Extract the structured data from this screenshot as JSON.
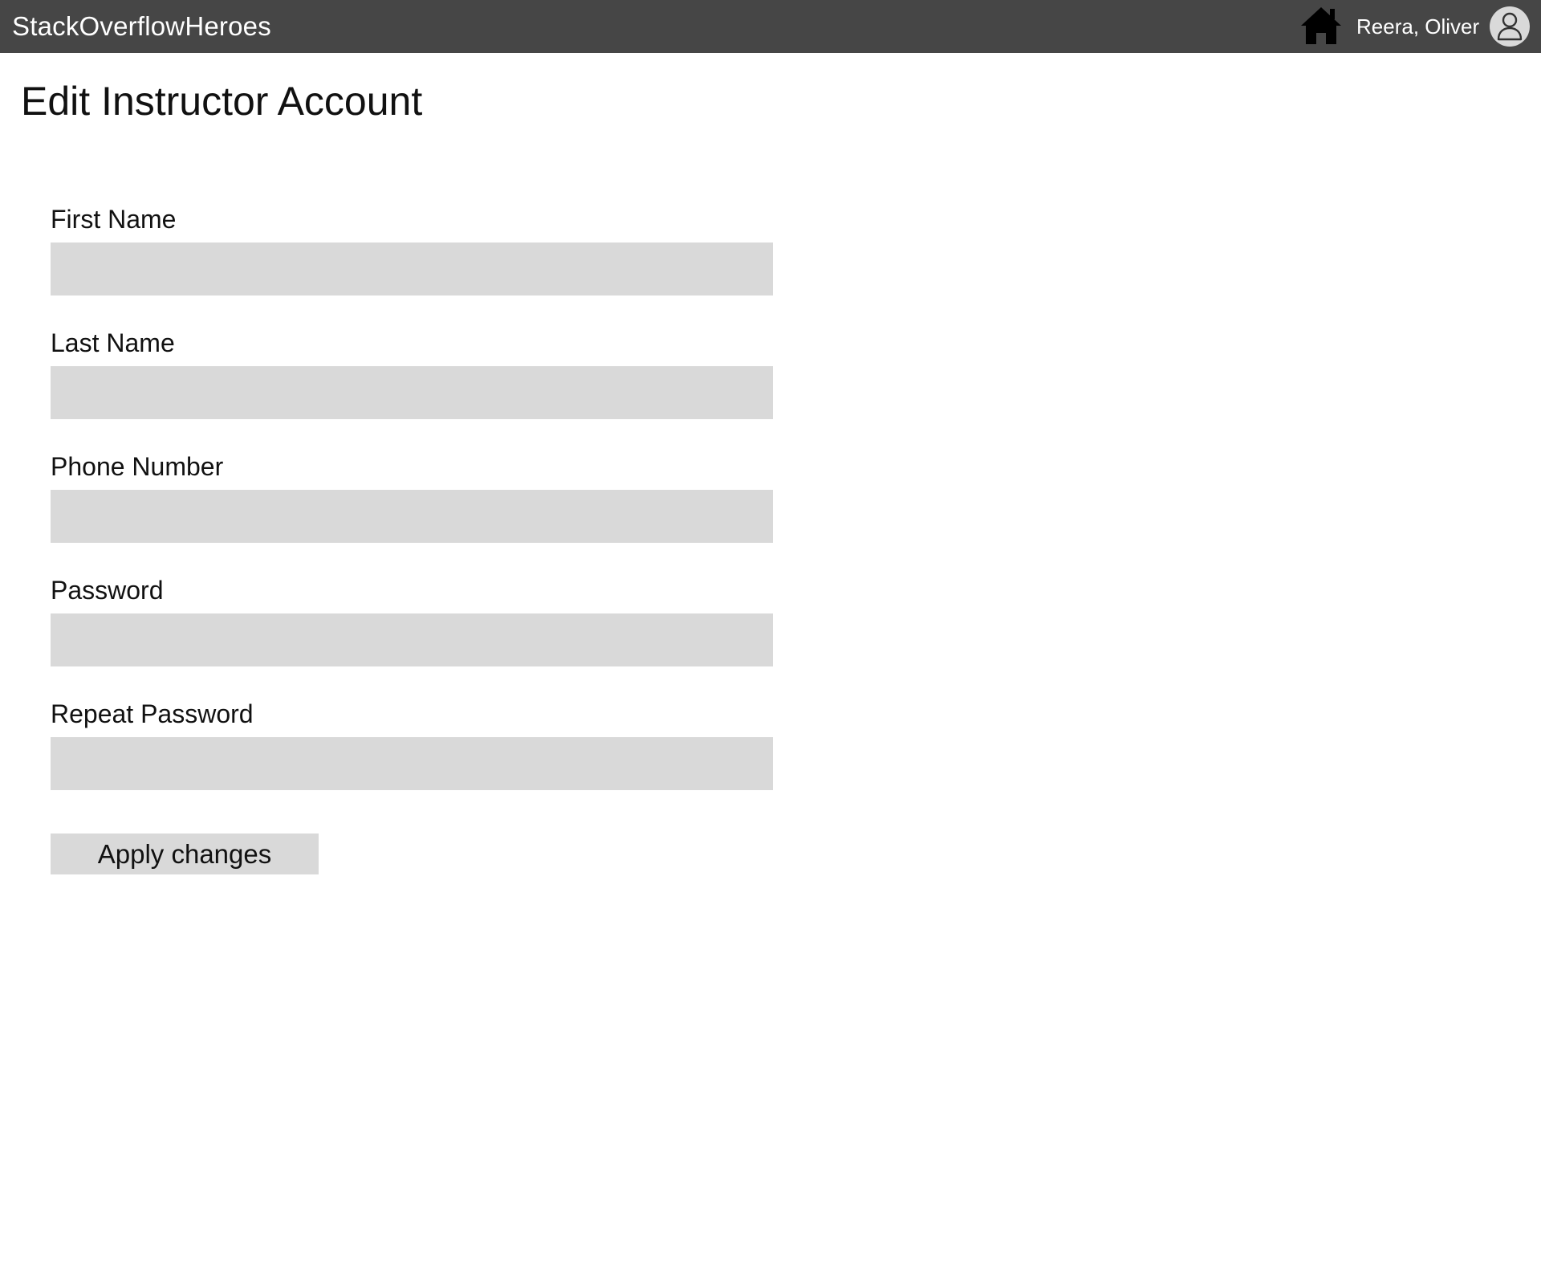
{
  "header": {
    "app_title": "StackOverflowHeroes",
    "user_name": "Reera, Oliver",
    "home_icon": "home-icon",
    "avatar_icon": "user-avatar-icon",
    "background_color": "#464646"
  },
  "page": {
    "title": "Edit Instructor Account"
  },
  "form": {
    "first_name": {
      "label": "First Name",
      "value": ""
    },
    "last_name": {
      "label": "Last Name",
      "value": ""
    },
    "phone_number": {
      "label": "Phone Number",
      "value": ""
    },
    "password": {
      "label": "Password",
      "value": ""
    },
    "repeat_password": {
      "label": "Repeat Password",
      "value": ""
    },
    "submit_label": "Apply changes"
  }
}
